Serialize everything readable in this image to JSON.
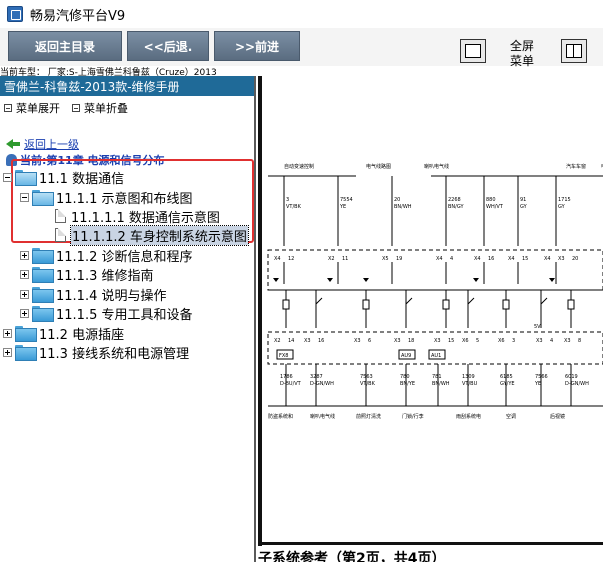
{
  "app": {
    "title": "畅易汽修平台V9"
  },
  "toolbar": {
    "home_label": "返回主目录",
    "back_label": "<<后退.",
    "forward_label": ">>前进",
    "fullscreen_label": "全屏",
    "menu_label": "菜单"
  },
  "vehicle": {
    "model_text": "当前车型： 厂家:S-上海雪佛兰科鲁兹（Cruze）2013"
  },
  "sidebar": {
    "manual_title": "雪佛兰-科鲁兹-2013款-维修手册",
    "expand_label": "菜单展开",
    "collapse_label": "菜单折叠",
    "back_link": "返回上一级",
    "current_chapter": "当前:第11章 电源和信号分布",
    "tree": [
      {
        "label": "11.1 数据通信"
      },
      {
        "label": "11.1.1 示意图和布线图"
      },
      {
        "label": "11.1.1.1 数据通信示意图"
      },
      {
        "label": "11.1.1.2 车身控制系统示意图"
      },
      {
        "label": "11.1.2 诊断信息和程序"
      },
      {
        "label": "11.1.3 维修指南"
      },
      {
        "label": "11.1.4 说明与操作"
      },
      {
        "label": "11.1.5 专用工具和设备"
      },
      {
        "label": "11.2 电源插座"
      },
      {
        "label": "11.3 接线系统和电源管理"
      }
    ]
  },
  "content": {
    "subsystem_label": "子系统参考（第2页，共4页）",
    "diagram": {
      "top_labels": [
        "自动变速控制",
        "电气线路图",
        "喇叭电气线",
        "汽车车窗",
        "电气线图"
      ],
      "wires_top": [
        {
          "num": "3",
          "color": "VT/BK"
        },
        {
          "num": "7554",
          "color": "YE"
        },
        {
          "num": "20",
          "color": "BN/WH"
        },
        {
          "num": "2268",
          "color": "BN/GY"
        },
        {
          "num": "880",
          "color": "WH/VT"
        },
        {
          "num": "91",
          "color": "GY"
        },
        {
          "num": "1715",
          "color": "GY"
        }
      ],
      "connectors_top": [
        "X4",
        "12",
        "X2",
        "11",
        "X5",
        "19",
        "X4",
        "4",
        "X4",
        "16",
        "X4",
        "15",
        "X4",
        "X3",
        "20"
      ],
      "connectors_bottom": [
        "X2",
        "14",
        "X3",
        "16",
        "X3",
        "6",
        "X3",
        "18",
        "X3",
        "15",
        "X6",
        "5",
        "X6",
        "3",
        "X3",
        "4",
        "X3",
        "8"
      ],
      "fuses": [
        "FX8",
        "AU9",
        "AU1"
      ],
      "wires_bottom": [
        {
          "num": "1786",
          "color": "D-BU/VT"
        },
        {
          "num": "3287",
          "color": "D-GN/WH"
        },
        {
          "num": "7563",
          "color": "VT/BK"
        },
        {
          "num": "780",
          "color": "BN/YE"
        },
        {
          "num": "781",
          "color": "BN/WH"
        },
        {
          "num": "1309",
          "color": "VT/BU"
        },
        {
          "num": "6185",
          "color": "GY/YE"
        },
        {
          "num": "7566",
          "color": "YE"
        },
        {
          "num": "6019",
          "color": "D-GN/WH"
        }
      ],
      "bottom_labels": [
        "防盗系统和",
        "喇叭电气线",
        "前照灯清洗",
        "门锁/行李",
        "雨刮系统电",
        "空调",
        "后视镜"
      ],
      "voltage_label": "5V"
    }
  }
}
